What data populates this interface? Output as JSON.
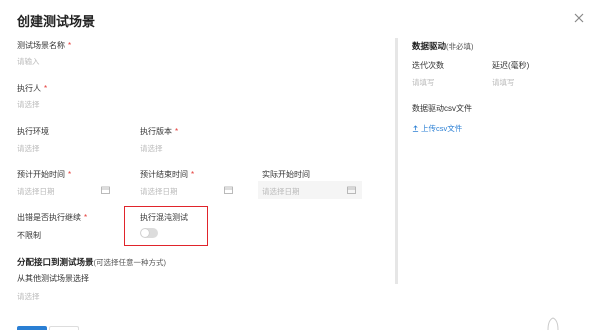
{
  "dialog": {
    "title": "创建测试场景"
  },
  "fields": {
    "scene_name": {
      "label": "测试场景名称",
      "placeholder": "请输入"
    },
    "executor": {
      "label": "执行人",
      "placeholder": "请选择"
    },
    "env": {
      "label": "执行环境",
      "placeholder": "请选择"
    },
    "version": {
      "label": "执行版本",
      "placeholder": "请选择"
    },
    "plan_start": {
      "label": "预计开始时间",
      "placeholder": "请选择日期"
    },
    "plan_end": {
      "label": "预计结束时间",
      "placeholder": "请选择日期"
    },
    "actual_start": {
      "label": "实际开始时间",
      "placeholder": "请选择日期"
    },
    "continue_on_error": {
      "label": "出错是否执行继续",
      "value": "不限制"
    },
    "chaos_test": {
      "label": "执行混沌测试",
      "enabled": false
    },
    "assign_section": {
      "title": "分配接口到测试场景",
      "note": "(可选择任意一种方式)"
    },
    "from_existing": {
      "label": "从其他测试场景选择",
      "placeholder": "请选择"
    }
  },
  "data_driven": {
    "title": "数据驱动",
    "note": "(非必填)",
    "iterations": {
      "label": "迭代次数",
      "placeholder": "请填写"
    },
    "delay": {
      "label": "延迟(毫秒)",
      "placeholder": "请填写"
    },
    "csv_label": "数据驱动csv文件",
    "upload_label": "上传csv文件"
  },
  "required_mark": "*",
  "colors": {
    "accent": "#2a7fd4",
    "required": "#e53935",
    "highlight": "#e0242b"
  }
}
